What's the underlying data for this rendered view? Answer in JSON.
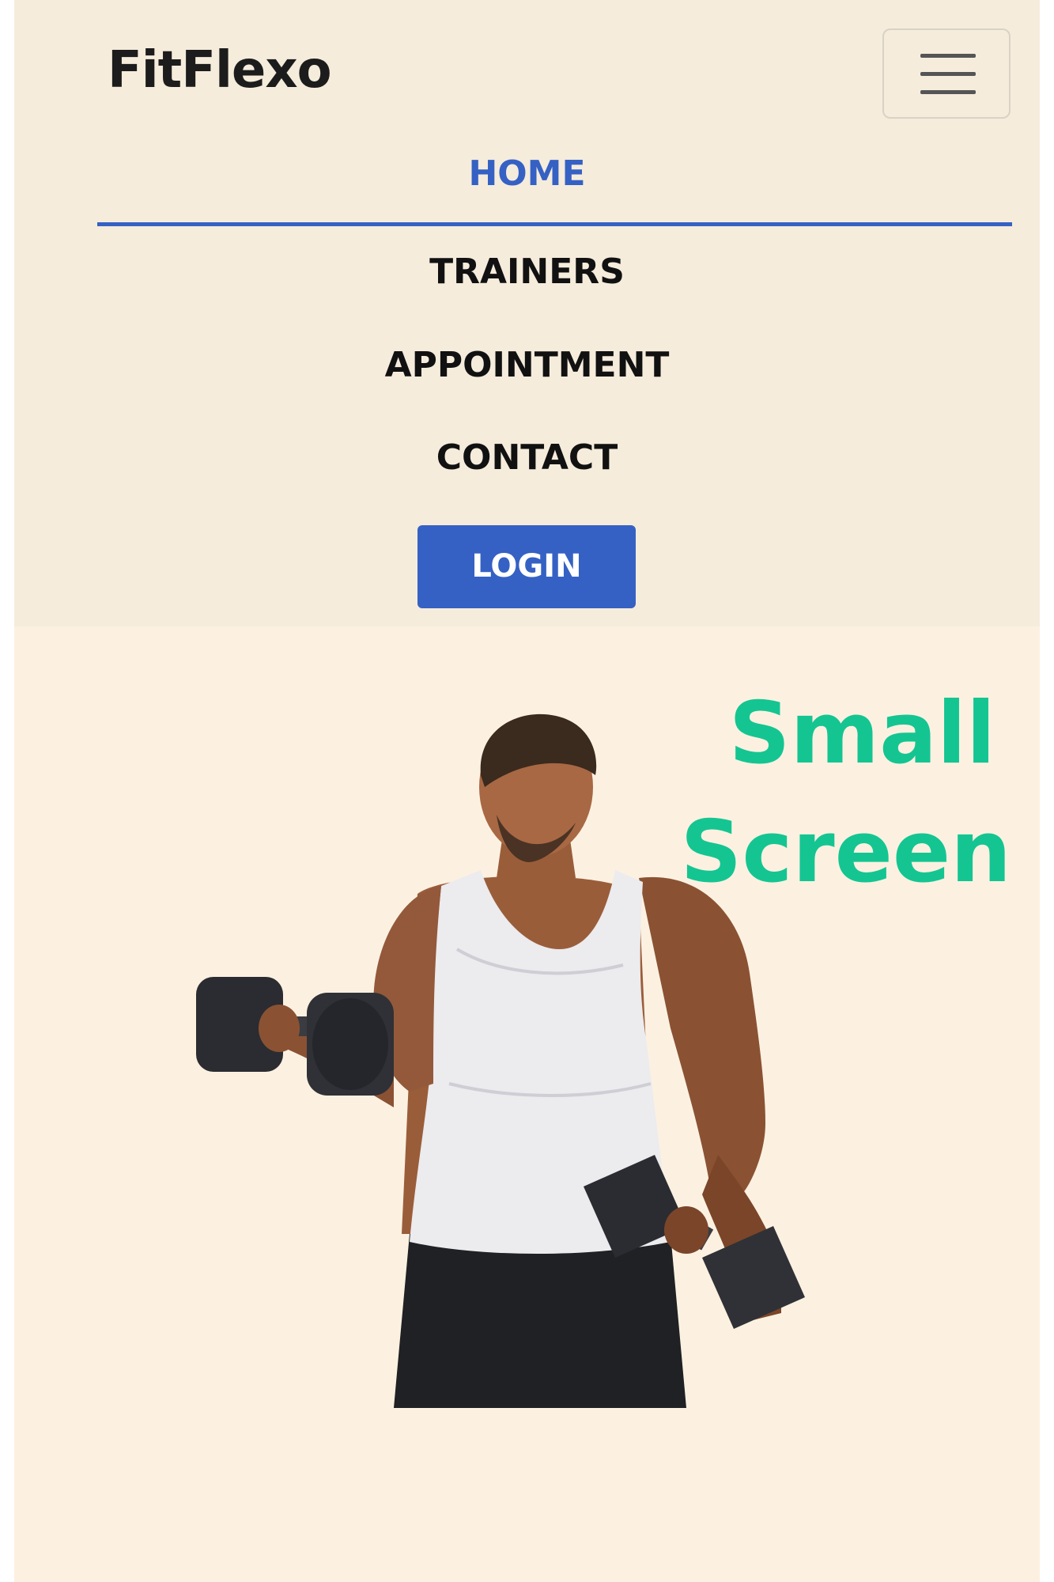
{
  "navbar": {
    "brand": "FitFlexo",
    "toggler_icon": "hamburger-icon",
    "items": [
      {
        "label": "HOME",
        "active": true
      },
      {
        "label": "TRAINERS",
        "active": false
      },
      {
        "label": "APPOINTMENT",
        "active": false
      },
      {
        "label": "CONTACT",
        "active": false
      }
    ],
    "login_label": "LOGIN"
  },
  "hero": {
    "overlay_line1": "Small",
    "overlay_line2": "Screen",
    "image": "man-lifting-dumbbells-photo"
  },
  "colors": {
    "accent": "#3561c4",
    "overlay_text": "#14c592",
    "navbar_bg": "#f5ecdc",
    "page_bg": "#fcf1e1"
  }
}
